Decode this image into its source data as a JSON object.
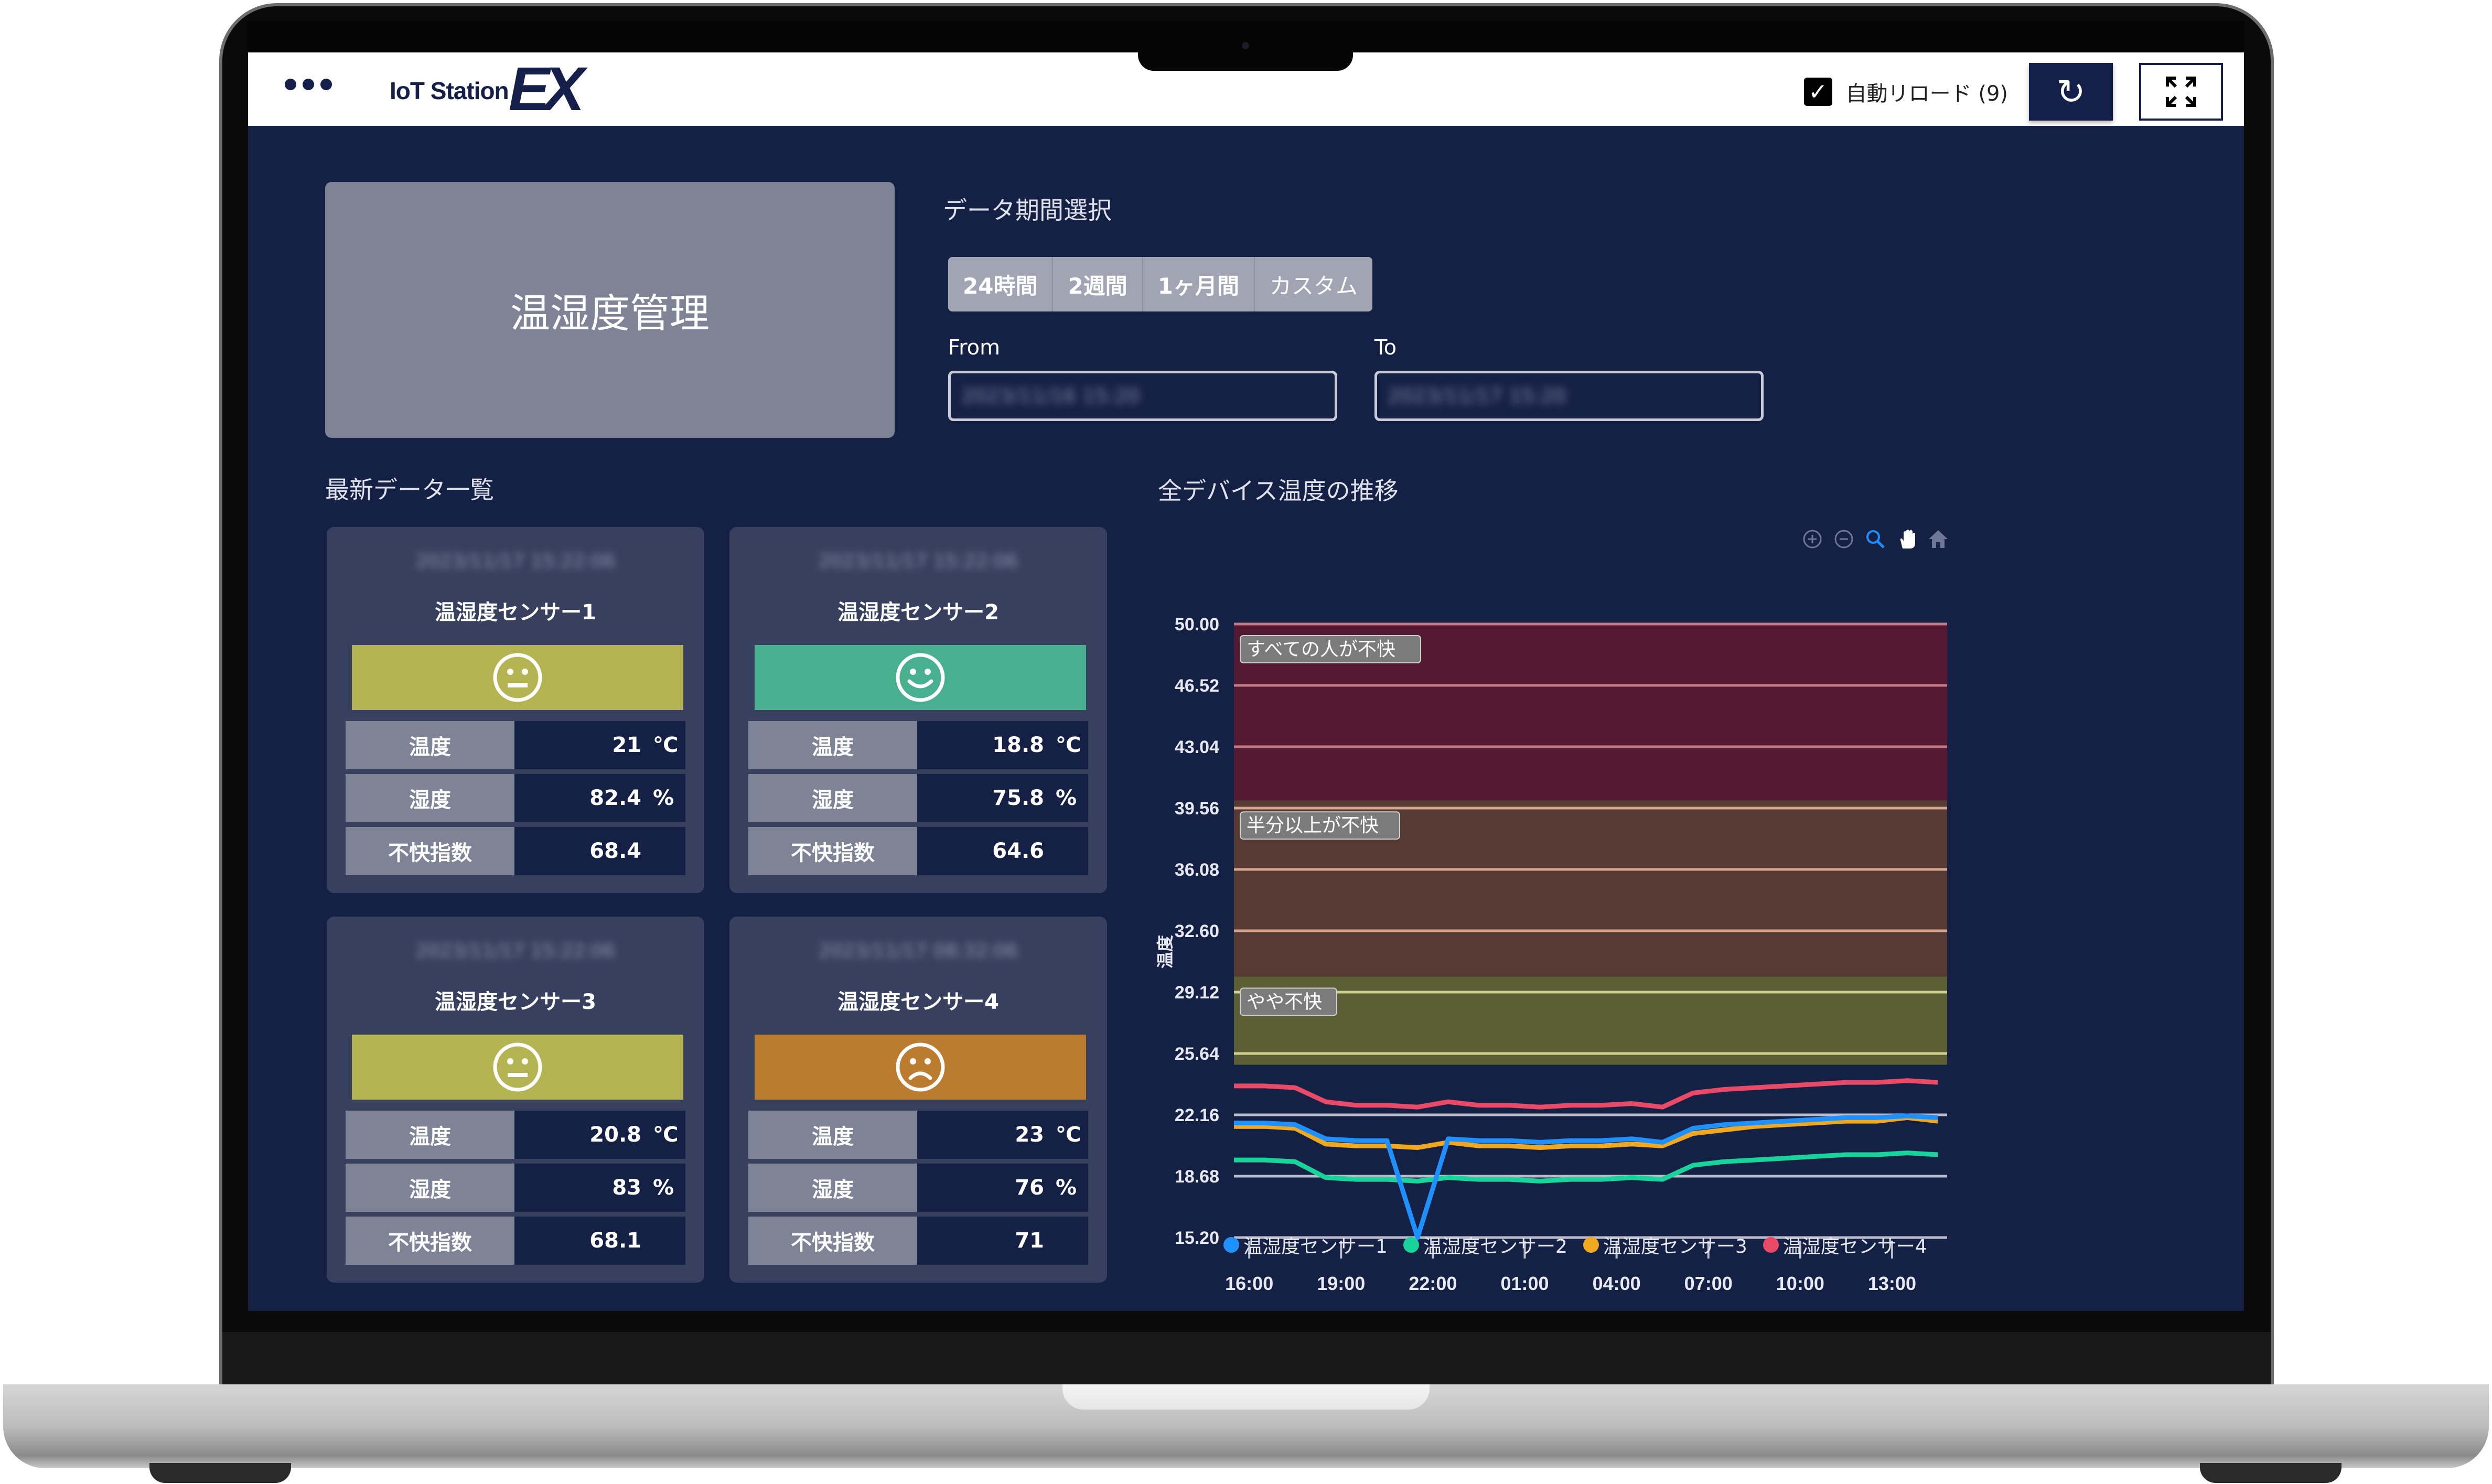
{
  "app": {
    "logo_text": "IoT Station",
    "logo_ex": "EX",
    "menu_icon": "more-horizontal-icon",
    "auto_reload_checked": true,
    "auto_reload_label": "自動リロード (9)",
    "refresh_icon": "↻",
    "fullscreen_icon": "⤢"
  },
  "page": {
    "title": "温湿度管理"
  },
  "period": {
    "title": "データ期間選択",
    "options": [
      "24時間",
      "2週間",
      "1ヶ月間",
      "カスタム"
    ],
    "from_label": "From",
    "to_label": "To",
    "from_value": "2023/11/16 15:20",
    "to_value": "2023/11/17 15:20"
  },
  "latest": {
    "title": "最新データ一覧",
    "sensors": [
      {
        "name": "温湿度センサー1",
        "timestamp": "2023/11/17 15:22:06",
        "status": "neutral",
        "status_color": "#b4b453",
        "rows": [
          {
            "label": "温度",
            "value": "21",
            "unit": "℃"
          },
          {
            "label": "湿度",
            "value": "82.4",
            "unit": "%"
          },
          {
            "label": "不快指数",
            "value": "68.4",
            "unit": ""
          }
        ]
      },
      {
        "name": "温湿度センサー2",
        "timestamp": "2023/11/17 15:22:06",
        "status": "happy",
        "status_color": "#48b08f",
        "rows": [
          {
            "label": "温度",
            "value": "18.8",
            "unit": "℃"
          },
          {
            "label": "湿度",
            "value": "75.8",
            "unit": "%"
          },
          {
            "label": "不快指数",
            "value": "64.6",
            "unit": ""
          }
        ]
      },
      {
        "name": "温湿度センサー3",
        "timestamp": "2023/11/17 15:22:06",
        "status": "neutral",
        "status_color": "#b4b453",
        "rows": [
          {
            "label": "温度",
            "value": "20.8",
            "unit": "℃"
          },
          {
            "label": "湿度",
            "value": "83",
            "unit": "%"
          },
          {
            "label": "不快指数",
            "value": "68.1",
            "unit": ""
          }
        ]
      },
      {
        "name": "温湿度センサー4",
        "timestamp": "2023/11/17 08:32:06",
        "status": "sad",
        "status_color": "#bb7c30",
        "rows": [
          {
            "label": "温度",
            "value": "23",
            "unit": "℃"
          },
          {
            "label": "湿度",
            "value": "76",
            "unit": "%"
          },
          {
            "label": "不快指数",
            "value": "71",
            "unit": ""
          }
        ]
      }
    ]
  },
  "chart_toolbar": [
    "zoom-in-icon",
    "zoom-out-icon",
    "zoom-select-icon",
    "pan-hand-icon",
    "reset-home-icon"
  ],
  "chart_data": {
    "type": "line",
    "title": "全デバイス温度の推移",
    "xlabel": "",
    "ylabel": "温度",
    "ylim": [
      15.2,
      50.0
    ],
    "y_ticks": [
      "50.00",
      "46.52",
      "43.04",
      "39.56",
      "36.08",
      "32.60",
      "29.12",
      "25.64",
      "22.16",
      "18.68",
      "15.20"
    ],
    "x_ticks": [
      "16:00",
      "19:00",
      "22:00",
      "01:00",
      "04:00",
      "07:00",
      "10:00",
      "13:00"
    ],
    "x_range_hours": [
      -0.5,
      22.8
    ],
    "grid": true,
    "legend": "bottom",
    "bands": [
      {
        "label": "すべての人が不快",
        "from": 40.0,
        "to": 50.0,
        "color": "#541a33",
        "line_color": "#c27a86"
      },
      {
        "label": "半分以上が不快",
        "from": 30.0,
        "to": 40.0,
        "color": "#573a33",
        "line_color": "#d4a58a"
      },
      {
        "label": "やや不快",
        "from": 25.0,
        "to": 30.0,
        "color": "#5b5f33",
        "line_color": "#cfcf90"
      }
    ],
    "x_hours": [
      -0.5,
      0.5,
      1.5,
      2.5,
      3.5,
      4.5,
      5.5,
      6.5,
      7.5,
      8.5,
      9.5,
      10.5,
      11.5,
      12.5,
      13.5,
      14.5,
      15.5,
      16.5,
      17.5,
      18.5,
      19.5,
      20.5,
      21.5,
      22.5
    ],
    "series": [
      {
        "name": "温湿度センサー1",
        "color": "#1e90ff",
        "values": [
          21.7,
          21.7,
          21.6,
          20.8,
          20.7,
          20.7,
          15.2,
          20.8,
          20.7,
          20.7,
          20.6,
          20.7,
          20.7,
          20.8,
          20.6,
          21.4,
          21.6,
          21.7,
          21.8,
          21.9,
          22.0,
          22.0,
          22.1,
          22.0
        ]
      },
      {
        "name": "温湿度センサー2",
        "color": "#18d49a",
        "values": [
          19.6,
          19.6,
          19.5,
          18.6,
          18.5,
          18.5,
          18.4,
          18.6,
          18.5,
          18.5,
          18.4,
          18.5,
          18.5,
          18.6,
          18.5,
          19.3,
          19.5,
          19.6,
          19.7,
          19.8,
          19.9,
          19.9,
          20.0,
          19.9
        ]
      },
      {
        "name": "温湿度センサー3",
        "color": "#f0a820",
        "values": [
          21.5,
          21.5,
          21.4,
          20.5,
          20.4,
          20.4,
          20.3,
          20.6,
          20.4,
          20.4,
          20.3,
          20.4,
          20.4,
          20.5,
          20.4,
          21.1,
          21.3,
          21.5,
          21.6,
          21.7,
          21.8,
          21.8,
          22.0,
          21.8
        ]
      },
      {
        "name": "温湿度センサー4",
        "color": "#e84a68",
        "values": [
          23.8,
          23.8,
          23.7,
          22.9,
          22.7,
          22.7,
          22.6,
          22.9,
          22.7,
          22.7,
          22.6,
          22.7,
          22.7,
          22.8,
          22.6,
          23.4,
          23.6,
          23.7,
          23.8,
          23.9,
          24.0,
          24.0,
          24.1,
          24.0
        ]
      }
    ]
  }
}
